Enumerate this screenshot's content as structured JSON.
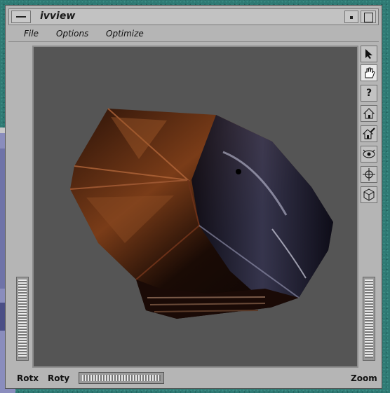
{
  "window": {
    "title": "ivview"
  },
  "menu": {
    "items": [
      "File",
      "Options",
      "Optimize"
    ]
  },
  "toolbar": {
    "tools": [
      {
        "name": "select-arrow-icon",
        "glyph": "arrow"
      },
      {
        "name": "view-hand-icon",
        "glyph": "hand",
        "active": true
      },
      {
        "name": "help-icon",
        "glyph": "?"
      },
      {
        "name": "home-icon",
        "glyph": "home"
      },
      {
        "name": "set-home-icon",
        "glyph": "sethome"
      },
      {
        "name": "view-all-icon",
        "glyph": "eye"
      },
      {
        "name": "seek-icon",
        "glyph": "crosshair"
      },
      {
        "name": "perspective-cube-icon",
        "glyph": "cube"
      }
    ]
  },
  "bottom": {
    "rotx": "Rotx",
    "roty": "Roty",
    "zoom": "Zoom"
  },
  "colors": {
    "viewer_bg": "#555555",
    "chrome": "#b5b5b5",
    "desktop": "#2f7a74"
  }
}
